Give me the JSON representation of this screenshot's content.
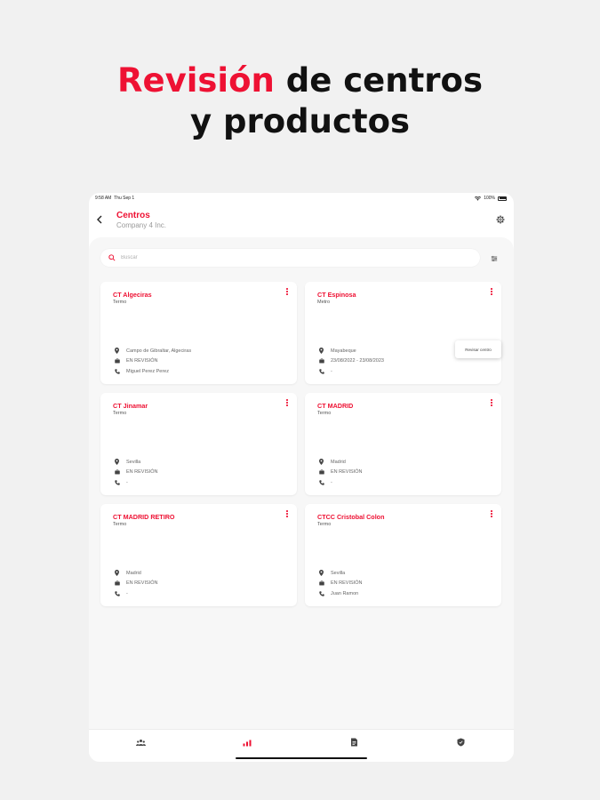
{
  "promo": {
    "accent": "Revisión",
    "line1_rest": "de centros",
    "line2": "y productos"
  },
  "status_bar": {
    "time": "9:58 AM",
    "date": "Thu Sep 1",
    "battery": "100%"
  },
  "header": {
    "title": "Centros",
    "subtitle": "Company 4 Inc."
  },
  "search": {
    "placeholder": "Buscar"
  },
  "cards": [
    {
      "title": "CT Algeciras",
      "type": "Termo",
      "location": "Campo de Gibraltar, Algeciras",
      "dates": "EN REVISIÓN",
      "contact": "Miguel Perez Perez"
    },
    {
      "title": "CT Espinosa",
      "type": "Metro",
      "location": "Mayabeque",
      "dates": "23/08/2022 - 23/08/2023",
      "contact": "-"
    },
    {
      "title": "CT Jinamar",
      "type": "Termo",
      "location": "Sevilla",
      "dates": "EN REVISIÓN",
      "contact": "-"
    },
    {
      "title": "CT MADRID",
      "type": "Termo",
      "location": "Madrid",
      "dates": "EN REVISIÓN",
      "contact": "-"
    },
    {
      "title": "CT MADRID RETIRO",
      "type": "Termo",
      "location": "Madrid",
      "dates": "EN REVISIÓN",
      "contact": "-"
    },
    {
      "title": "CTCC Cristobal Colon",
      "type": "Termo",
      "location": "Sevilla",
      "dates": "EN REVISIÓN",
      "contact": "Juan Ramon"
    }
  ],
  "context_menu": {
    "item": "Revisar centro"
  },
  "bottom_nav": [
    "people-icon",
    "chart-icon",
    "document-icon",
    "shield-icon"
  ],
  "colors": {
    "accent": "#ee1133",
    "background": "#f1f1f1"
  }
}
